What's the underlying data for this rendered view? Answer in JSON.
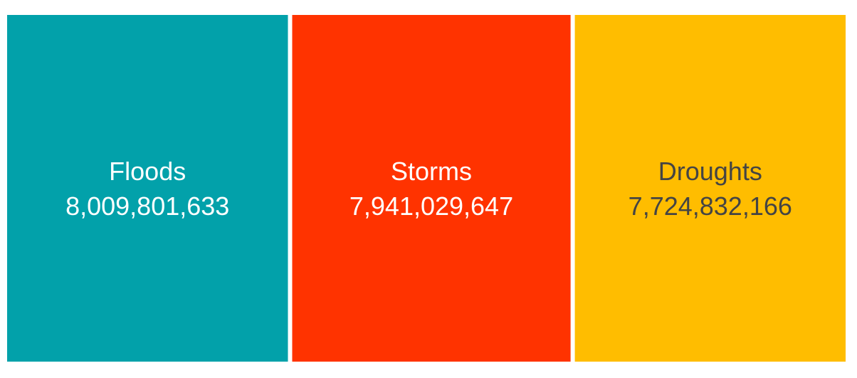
{
  "chart_data": {
    "type": "treemap",
    "items": [
      {
        "name": "Floods",
        "value": 8009801633,
        "value_label": "8,009,801,633",
        "color": "#02A1AA",
        "text_color": "#ffffff"
      },
      {
        "name": "Storms",
        "value": 7941029647,
        "value_label": "7,941,029,647",
        "color": "#FF3300",
        "text_color": "#ffffff"
      },
      {
        "name": "Droughts",
        "value": 7724832166,
        "value_label": "7,724,832,166",
        "color": "#FFBD00",
        "text_color": "#444444"
      }
    ]
  }
}
